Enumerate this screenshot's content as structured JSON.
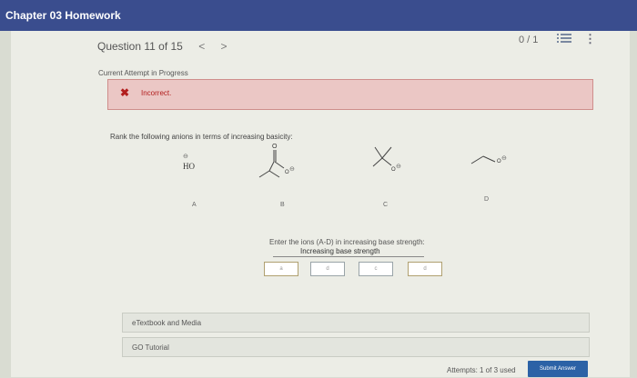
{
  "header": {
    "title": "Chapter 03 Homework"
  },
  "question_nav": {
    "label": "Question 11 of 15",
    "prev": "<",
    "next": ">"
  },
  "score": "0 / 1",
  "icons": {
    "list": "list-icon",
    "more": "more-vertical-icon",
    "incorrect": "x-icon"
  },
  "attempt_status": "Current Attempt in Progress",
  "feedback": {
    "mark": "✖",
    "message": "Incorrect."
  },
  "question": {
    "prompt": "Rank the following anions in terms of increasing basicity:"
  },
  "structures": {
    "a": {
      "charge": "⊖",
      "formula": "HO",
      "label": "A"
    },
    "b": {
      "o_top": "O",
      "o_anion": "O",
      "charge": "⊖",
      "label": "B"
    },
    "c": {
      "o_anion": "O",
      "charge": "⊖",
      "label": "C"
    },
    "d": {
      "o_anion": "O",
      "charge": "⊖",
      "label": "D"
    }
  },
  "answer_entry": {
    "instruction": "Enter the ions (A-D) in increasing base strength:",
    "subheader": "Increasing base strength",
    "slots": [
      "a",
      "d",
      "c",
      "d"
    ]
  },
  "links": {
    "etextbook": "eTextbook and Media",
    "go_tutorial": "GO Tutorial"
  },
  "footer": {
    "attempts": "Attempts: 1 of 3 used",
    "submit": "Submit Answer"
  },
  "colors": {
    "header_bg": "#3a4d8e",
    "error_bg": "#ebc7c5",
    "error_text": "#b21e1e",
    "submit_bg": "#2c62a6"
  }
}
